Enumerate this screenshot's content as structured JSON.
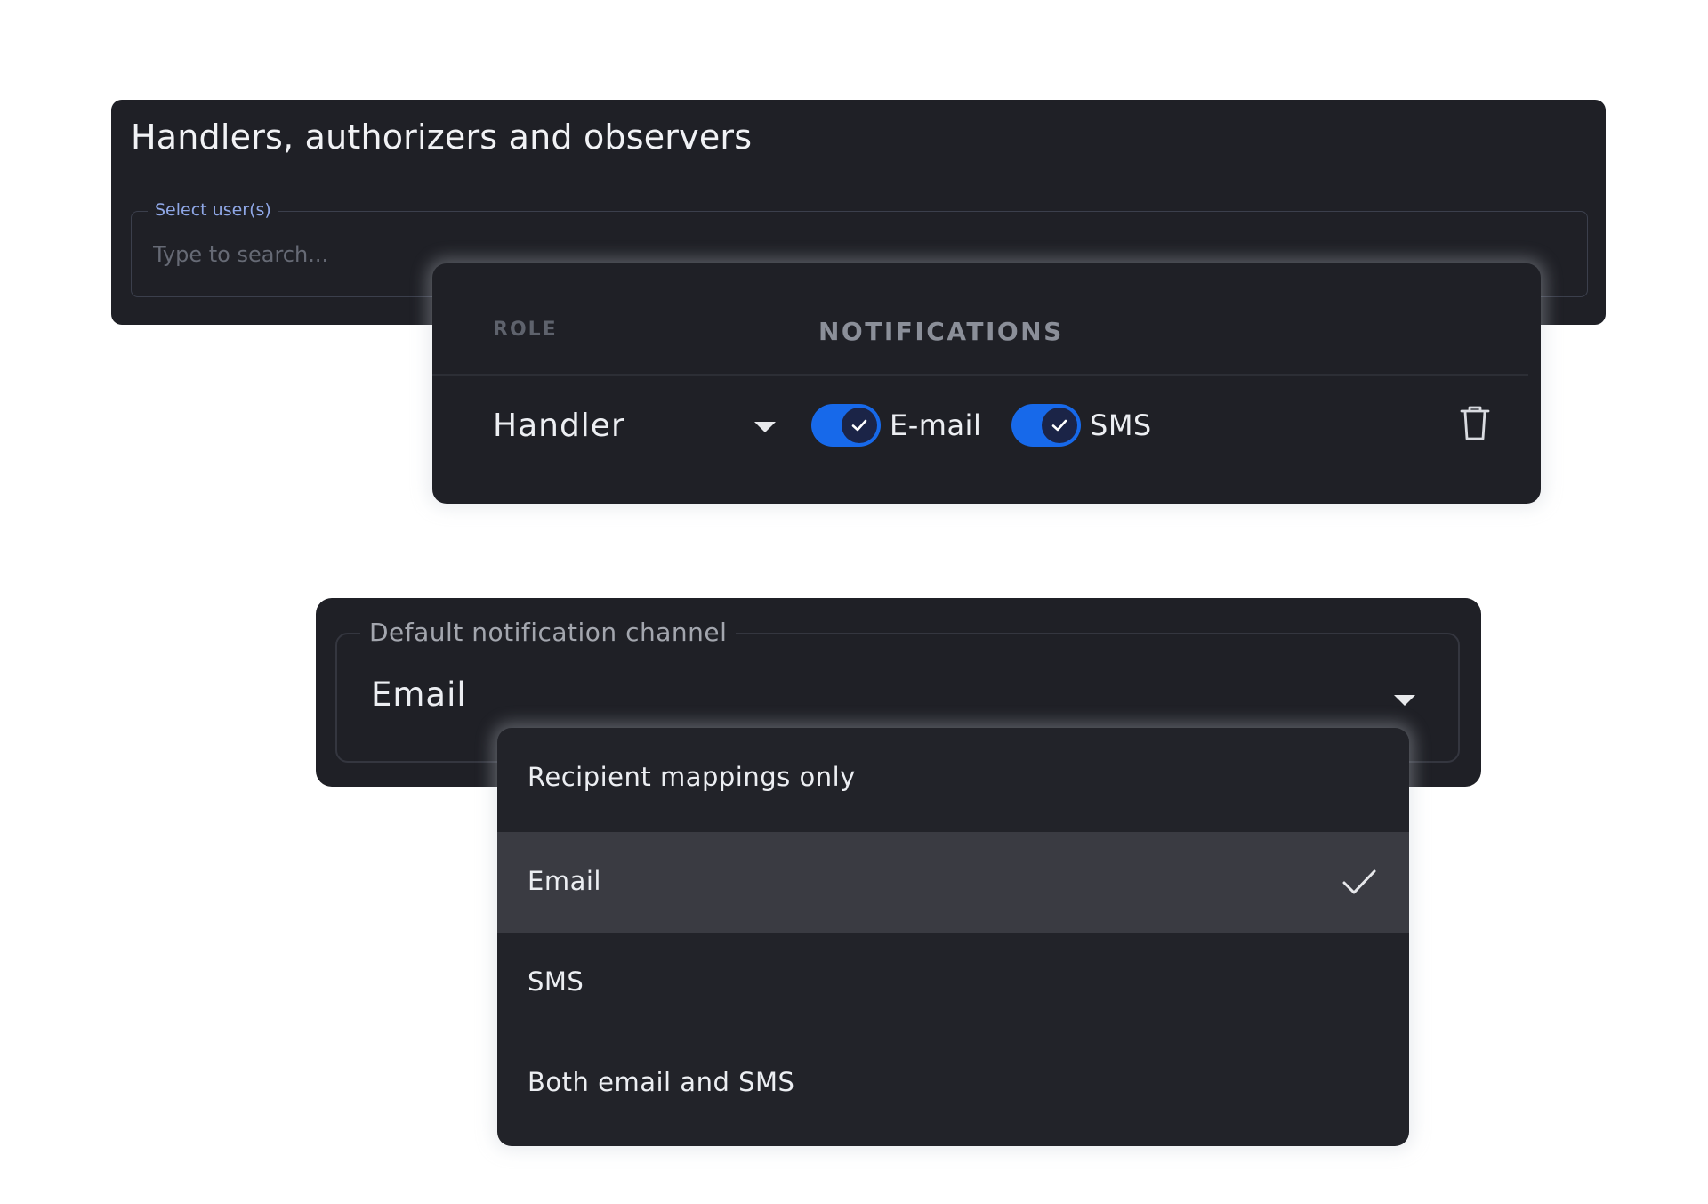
{
  "handlers_panel": {
    "title": "Handlers, authorizers and observers",
    "user_field": {
      "label": "Select user(s)",
      "placeholder": "Type to search...",
      "value": ""
    }
  },
  "roles_panel": {
    "headers": {
      "role": "ROLE",
      "notifications": "NOTIFICATIONS"
    },
    "row": {
      "role": "Handler",
      "notifications": [
        {
          "label": "E-mail",
          "enabled": true
        },
        {
          "label": "SMS",
          "enabled": true
        }
      ],
      "delete_icon": "trash-icon"
    }
  },
  "channel_panel": {
    "label": "Default notification channel",
    "selected": "Email",
    "options": [
      {
        "label": "Recipient mappings only",
        "selected": false
      },
      {
        "label": "Email",
        "selected": true
      },
      {
        "label": "SMS",
        "selected": false
      },
      {
        "label": "Both email and SMS",
        "selected": false
      }
    ]
  },
  "colors": {
    "panel_bg": "#1f2026",
    "toggle_on": "#1769ea",
    "selected_option_bg": "#3a3b42",
    "field_label_accent": "#8fa7e6"
  }
}
